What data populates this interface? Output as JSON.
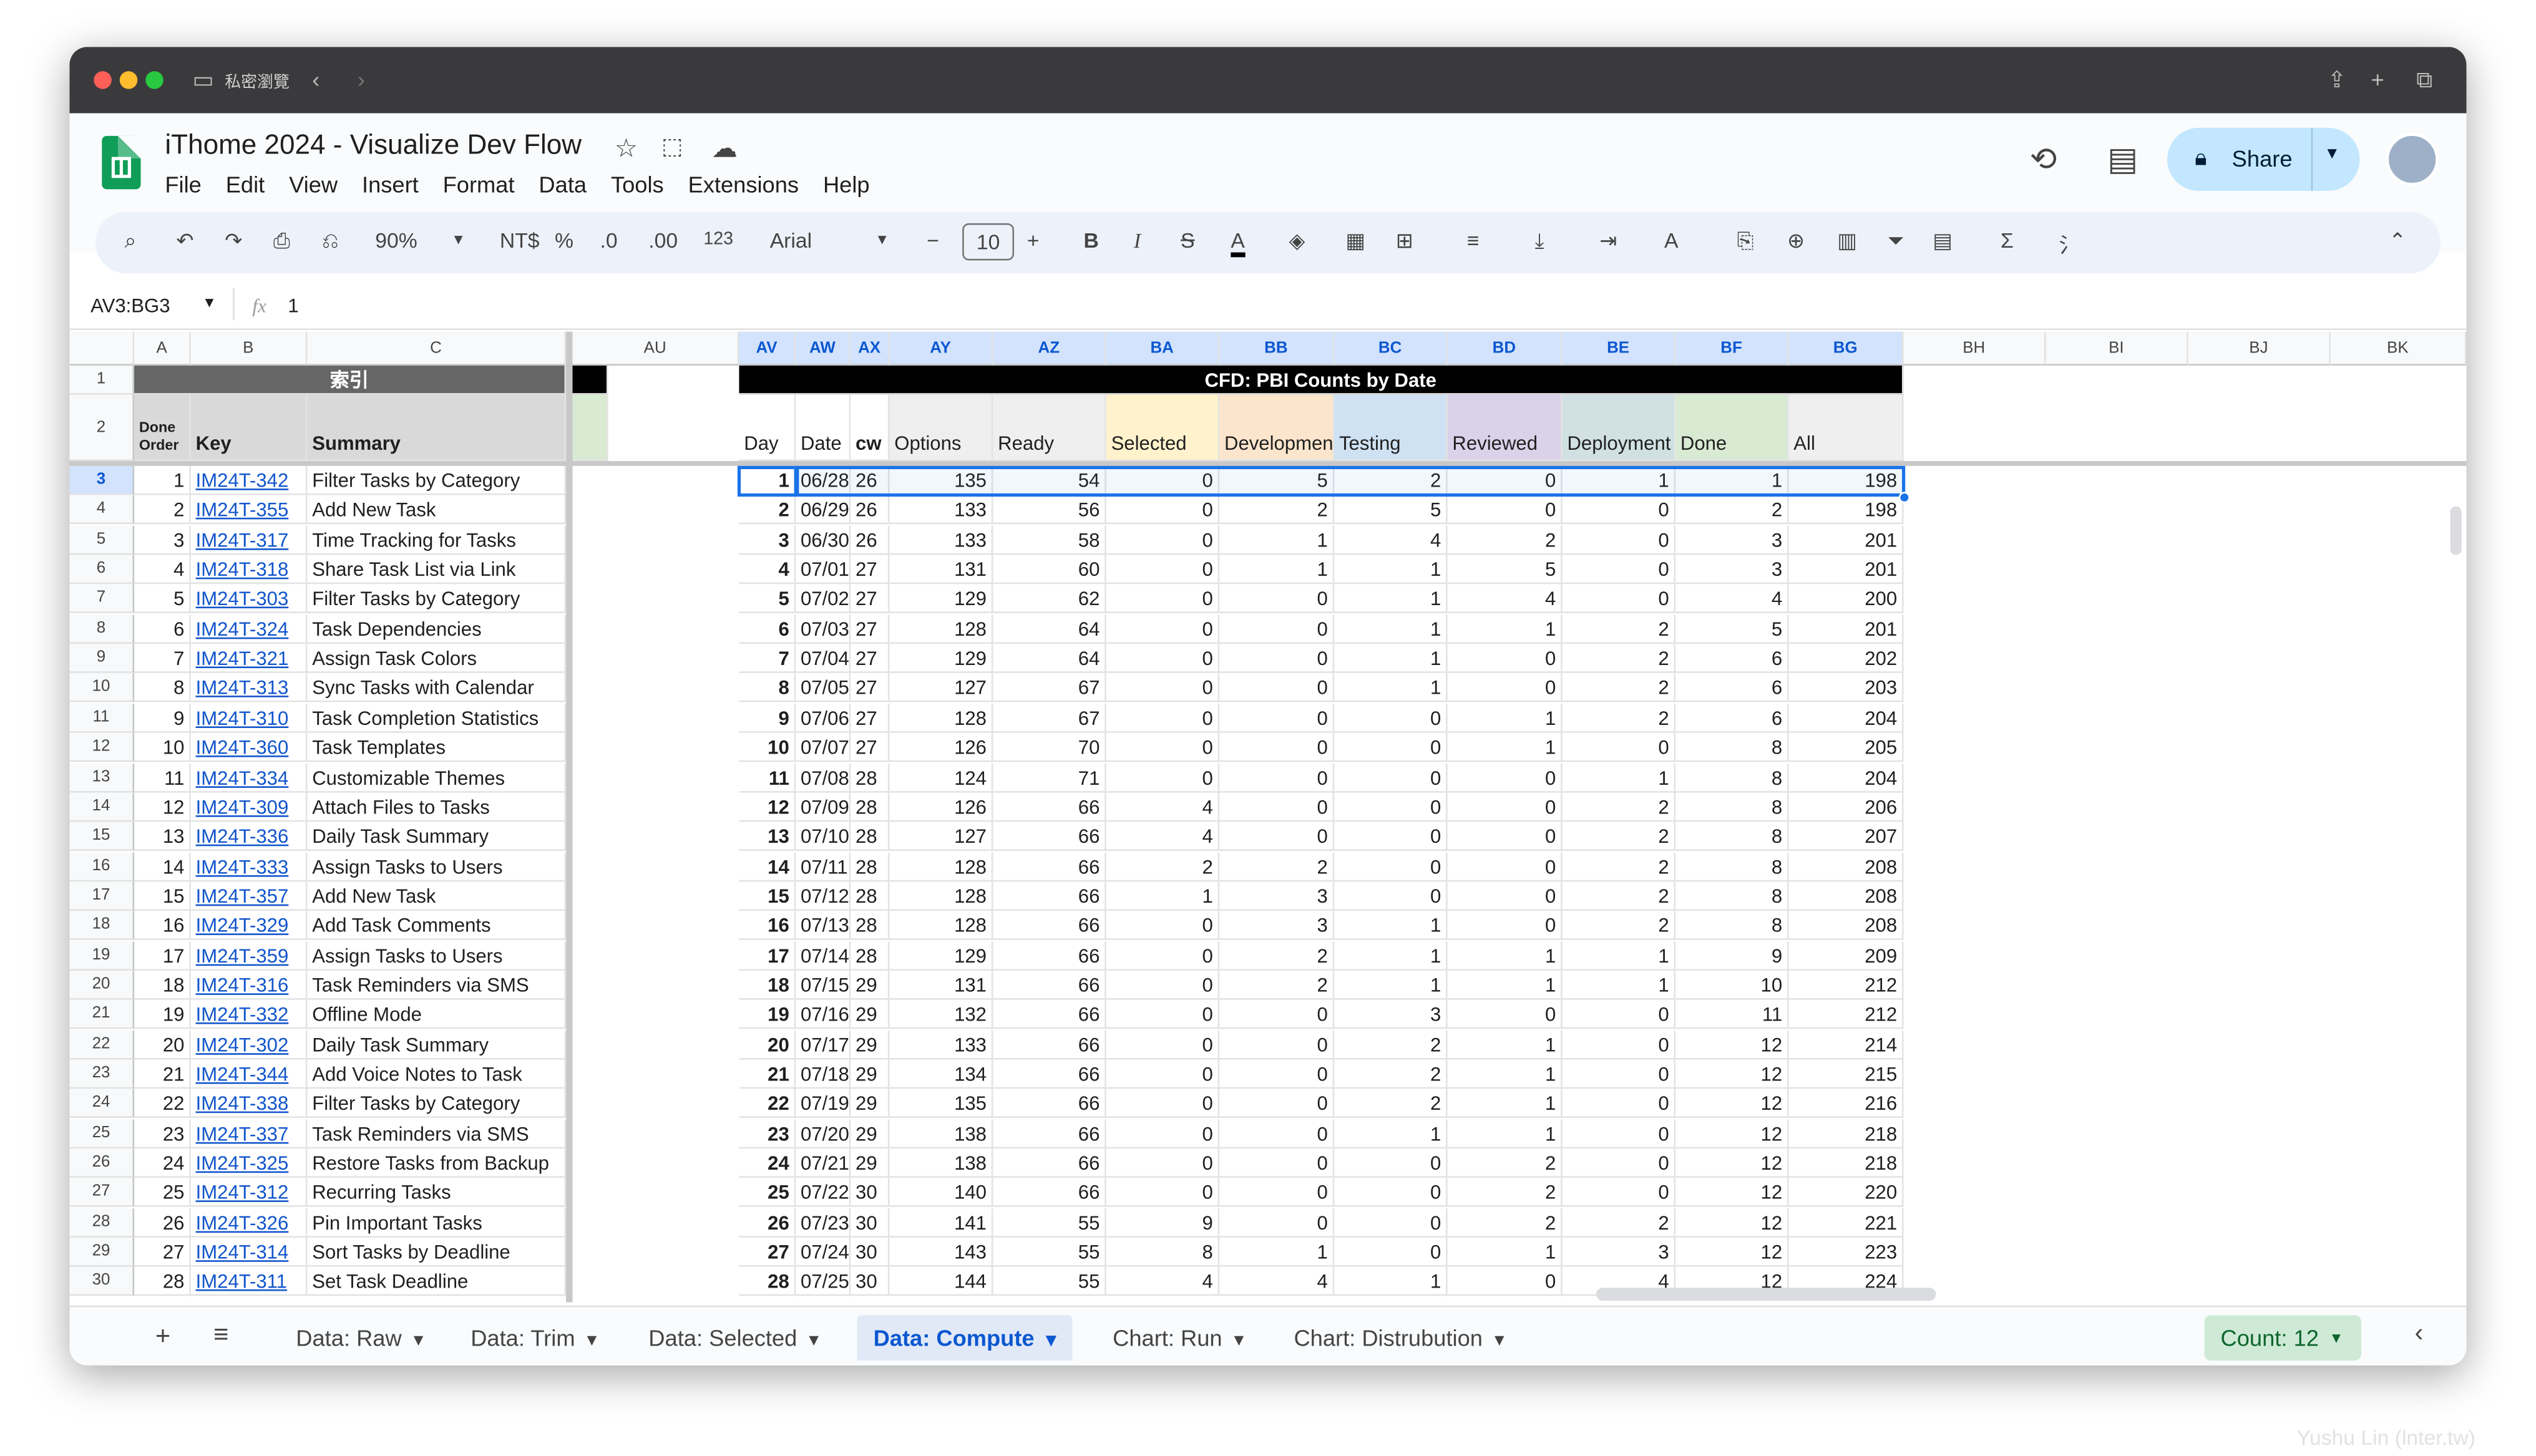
{
  "browser": {
    "private_label": "私密瀏覽"
  },
  "doc": {
    "title": "iThome 2024 - Visualize Dev Flow",
    "share_label": "Share"
  },
  "menu": [
    "File",
    "Edit",
    "View",
    "Insert",
    "Format",
    "Data",
    "Tools",
    "Extensions",
    "Help"
  ],
  "toolbar": {
    "zoom": "90%",
    "currency": "NT$",
    "percent": "%",
    "dec_dec": ".0",
    "dec_inc": ".00",
    "number_fmt": "123",
    "font": "Arial",
    "font_size": "10"
  },
  "formula_bar": {
    "range": "AV3:BG3",
    "fx": "fx",
    "value": "1"
  },
  "columns": {
    "A": "A",
    "B": "B",
    "C": "C",
    "AU": "AU",
    "AV": "AV",
    "AW": "AW",
    "AX": "AX",
    "AY": "AY",
    "AZ": "AZ",
    "BA": "BA",
    "BB": "BB",
    "BC": "BC",
    "BD": "BD",
    "BE": "BE",
    "BF": "BF",
    "BG": "BG",
    "BH": "BH",
    "BI": "BI",
    "BJ": "BJ",
    "BK": "BK"
  },
  "row1": {
    "index_title": "索引",
    "cfd_title": "CFD: PBI Counts by Date"
  },
  "row2": {
    "done_order": "Done Order",
    "key": "Key",
    "summary": "Summary",
    "day": "Day",
    "date": "Date",
    "cw": "cw",
    "options": "Options",
    "ready": "Ready",
    "selected": "Selected",
    "development": "Development",
    "testing": "Testing",
    "reviewed": "Reviewed",
    "deployment": "Deployment",
    "done": "Done",
    "all": "All"
  },
  "stage_colors": {
    "options": "#efefef",
    "selected": "#fff2cc",
    "development": "#fce5cd",
    "testing": "#cfe2f3",
    "reviewed": "#d9d2e9",
    "deployment": "#d0e0e3",
    "done": "#d9ead3"
  },
  "rows": [
    {
      "rn": "3",
      "done": "1",
      "key": "IM24T-342",
      "summary": "Filter Tasks by Category",
      "day": "1",
      "date": "06/28",
      "cw": "26",
      "options": "135",
      "ready": "54",
      "selected": "0",
      "dev": "5",
      "testing": "2",
      "reviewed": "0",
      "deploy": "1",
      "donec": "1",
      "all": "198"
    },
    {
      "rn": "4",
      "done": "2",
      "key": "IM24T-355",
      "summary": "Add New Task",
      "day": "2",
      "date": "06/29",
      "cw": "26",
      "options": "133",
      "ready": "56",
      "selected": "0",
      "dev": "2",
      "testing": "5",
      "reviewed": "0",
      "deploy": "0",
      "donec": "2",
      "all": "198"
    },
    {
      "rn": "5",
      "done": "3",
      "key": "IM24T-317",
      "summary": "Time Tracking for Tasks",
      "day": "3",
      "date": "06/30",
      "cw": "26",
      "options": "133",
      "ready": "58",
      "selected": "0",
      "dev": "1",
      "testing": "4",
      "reviewed": "2",
      "deploy": "0",
      "donec": "3",
      "all": "201"
    },
    {
      "rn": "6",
      "done": "4",
      "key": "IM24T-318",
      "summary": "Share Task List via Link",
      "day": "4",
      "date": "07/01",
      "cw": "27",
      "options": "131",
      "ready": "60",
      "selected": "0",
      "dev": "1",
      "testing": "1",
      "reviewed": "5",
      "deploy": "0",
      "donec": "3",
      "all": "201"
    },
    {
      "rn": "7",
      "done": "5",
      "key": "IM24T-303",
      "summary": "Filter Tasks by Category",
      "day": "5",
      "date": "07/02",
      "cw": "27",
      "options": "129",
      "ready": "62",
      "selected": "0",
      "dev": "0",
      "testing": "1",
      "reviewed": "4",
      "deploy": "0",
      "donec": "4",
      "all": "200"
    },
    {
      "rn": "8",
      "done": "6",
      "key": "IM24T-324",
      "summary": "Task Dependencies",
      "day": "6",
      "date": "07/03",
      "cw": "27",
      "options": "128",
      "ready": "64",
      "selected": "0",
      "dev": "0",
      "testing": "1",
      "reviewed": "1",
      "deploy": "2",
      "donec": "5",
      "all": "201"
    },
    {
      "rn": "9",
      "done": "7",
      "key": "IM24T-321",
      "summary": "Assign Task Colors",
      "day": "7",
      "date": "07/04",
      "cw": "27",
      "options": "129",
      "ready": "64",
      "selected": "0",
      "dev": "0",
      "testing": "1",
      "reviewed": "0",
      "deploy": "2",
      "donec": "6",
      "all": "202"
    },
    {
      "rn": "10",
      "done": "8",
      "key": "IM24T-313",
      "summary": "Sync Tasks with Calendar",
      "day": "8",
      "date": "07/05",
      "cw": "27",
      "options": "127",
      "ready": "67",
      "selected": "0",
      "dev": "0",
      "testing": "1",
      "reviewed": "0",
      "deploy": "2",
      "donec": "6",
      "all": "203"
    },
    {
      "rn": "11",
      "done": "9",
      "key": "IM24T-310",
      "summary": "Task Completion Statistics",
      "day": "9",
      "date": "07/06",
      "cw": "27",
      "options": "128",
      "ready": "67",
      "selected": "0",
      "dev": "0",
      "testing": "0",
      "reviewed": "1",
      "deploy": "2",
      "donec": "6",
      "all": "204"
    },
    {
      "rn": "12",
      "done": "10",
      "key": "IM24T-360",
      "summary": "Task Templates",
      "day": "10",
      "date": "07/07",
      "cw": "27",
      "options": "126",
      "ready": "70",
      "selected": "0",
      "dev": "0",
      "testing": "0",
      "reviewed": "1",
      "deploy": "0",
      "donec": "8",
      "all": "205"
    },
    {
      "rn": "13",
      "done": "11",
      "key": "IM24T-334",
      "summary": "Customizable Themes",
      "day": "11",
      "date": "07/08",
      "cw": "28",
      "options": "124",
      "ready": "71",
      "selected": "0",
      "dev": "0",
      "testing": "0",
      "reviewed": "0",
      "deploy": "1",
      "donec": "8",
      "all": "204"
    },
    {
      "rn": "14",
      "done": "12",
      "key": "IM24T-309",
      "summary": "Attach Files to Tasks",
      "day": "12",
      "date": "07/09",
      "cw": "28",
      "options": "126",
      "ready": "66",
      "selected": "4",
      "dev": "0",
      "testing": "0",
      "reviewed": "0",
      "deploy": "2",
      "donec": "8",
      "all": "206"
    },
    {
      "rn": "15",
      "done": "13",
      "key": "IM24T-336",
      "summary": "Daily Task Summary",
      "day": "13",
      "date": "07/10",
      "cw": "28",
      "options": "127",
      "ready": "66",
      "selected": "4",
      "dev": "0",
      "testing": "0",
      "reviewed": "0",
      "deploy": "2",
      "donec": "8",
      "all": "207"
    },
    {
      "rn": "16",
      "done": "14",
      "key": "IM24T-333",
      "summary": "Assign Tasks to Users",
      "day": "14",
      "date": "07/11",
      "cw": "28",
      "options": "128",
      "ready": "66",
      "selected": "2",
      "dev": "2",
      "testing": "0",
      "reviewed": "0",
      "deploy": "2",
      "donec": "8",
      "all": "208"
    },
    {
      "rn": "17",
      "done": "15",
      "key": "IM24T-357",
      "summary": "Add New Task",
      "day": "15",
      "date": "07/12",
      "cw": "28",
      "options": "128",
      "ready": "66",
      "selected": "1",
      "dev": "3",
      "testing": "0",
      "reviewed": "0",
      "deploy": "2",
      "donec": "8",
      "all": "208"
    },
    {
      "rn": "18",
      "done": "16",
      "key": "IM24T-329",
      "summary": "Add Task Comments",
      "day": "16",
      "date": "07/13",
      "cw": "28",
      "options": "128",
      "ready": "66",
      "selected": "0",
      "dev": "3",
      "testing": "1",
      "reviewed": "0",
      "deploy": "2",
      "donec": "8",
      "all": "208"
    },
    {
      "rn": "19",
      "done": "17",
      "key": "IM24T-359",
      "summary": "Assign Tasks to Users",
      "day": "17",
      "date": "07/14",
      "cw": "28",
      "options": "129",
      "ready": "66",
      "selected": "0",
      "dev": "2",
      "testing": "1",
      "reviewed": "1",
      "deploy": "1",
      "donec": "9",
      "all": "209"
    },
    {
      "rn": "20",
      "done": "18",
      "key": "IM24T-316",
      "summary": "Task Reminders via SMS",
      "day": "18",
      "date": "07/15",
      "cw": "29",
      "options": "131",
      "ready": "66",
      "selected": "0",
      "dev": "2",
      "testing": "1",
      "reviewed": "1",
      "deploy": "1",
      "donec": "10",
      "all": "212"
    },
    {
      "rn": "21",
      "done": "19",
      "key": "IM24T-332",
      "summary": "Offline Mode",
      "day": "19",
      "date": "07/16",
      "cw": "29",
      "options": "132",
      "ready": "66",
      "selected": "0",
      "dev": "0",
      "testing": "3",
      "reviewed": "0",
      "deploy": "0",
      "donec": "11",
      "all": "212"
    },
    {
      "rn": "22",
      "done": "20",
      "key": "IM24T-302",
      "summary": "Daily Task Summary",
      "day": "20",
      "date": "07/17",
      "cw": "29",
      "options": "133",
      "ready": "66",
      "selected": "0",
      "dev": "0",
      "testing": "2",
      "reviewed": "1",
      "deploy": "0",
      "donec": "12",
      "all": "214"
    },
    {
      "rn": "23",
      "done": "21",
      "key": "IM24T-344",
      "summary": "Add Voice Notes to Task",
      "day": "21",
      "date": "07/18",
      "cw": "29",
      "options": "134",
      "ready": "66",
      "selected": "0",
      "dev": "0",
      "testing": "2",
      "reviewed": "1",
      "deploy": "0",
      "donec": "12",
      "all": "215"
    },
    {
      "rn": "24",
      "done": "22",
      "key": "IM24T-338",
      "summary": "Filter Tasks by Category",
      "day": "22",
      "date": "07/19",
      "cw": "29",
      "options": "135",
      "ready": "66",
      "selected": "0",
      "dev": "0",
      "testing": "2",
      "reviewed": "1",
      "deploy": "0",
      "donec": "12",
      "all": "216"
    },
    {
      "rn": "25",
      "done": "23",
      "key": "IM24T-337",
      "summary": "Task Reminders via SMS",
      "day": "23",
      "date": "07/20",
      "cw": "29",
      "options": "138",
      "ready": "66",
      "selected": "0",
      "dev": "0",
      "testing": "1",
      "reviewed": "1",
      "deploy": "0",
      "donec": "12",
      "all": "218"
    },
    {
      "rn": "26",
      "done": "24",
      "key": "IM24T-325",
      "summary": "Restore Tasks from Backup",
      "day": "24",
      "date": "07/21",
      "cw": "29",
      "options": "138",
      "ready": "66",
      "selected": "0",
      "dev": "0",
      "testing": "0",
      "reviewed": "2",
      "deploy": "0",
      "donec": "12",
      "all": "218"
    },
    {
      "rn": "27",
      "done": "25",
      "key": "IM24T-312",
      "summary": "Recurring Tasks",
      "day": "25",
      "date": "07/22",
      "cw": "30",
      "options": "140",
      "ready": "66",
      "selected": "0",
      "dev": "0",
      "testing": "0",
      "reviewed": "2",
      "deploy": "0",
      "donec": "12",
      "all": "220"
    },
    {
      "rn": "28",
      "done": "26",
      "key": "IM24T-326",
      "summary": "Pin Important Tasks",
      "day": "26",
      "date": "07/23",
      "cw": "30",
      "options": "141",
      "ready": "55",
      "selected": "9",
      "dev": "0",
      "testing": "0",
      "reviewed": "2",
      "deploy": "2",
      "donec": "12",
      "all": "221"
    },
    {
      "rn": "29",
      "done": "27",
      "key": "IM24T-314",
      "summary": "Sort Tasks by Deadline",
      "day": "27",
      "date": "07/24",
      "cw": "30",
      "options": "143",
      "ready": "55",
      "selected": "8",
      "dev": "1",
      "testing": "0",
      "reviewed": "1",
      "deploy": "3",
      "donec": "12",
      "all": "223"
    },
    {
      "rn": "30",
      "done": "28",
      "key": "IM24T-311",
      "summary": "Set Task Deadline",
      "day": "28",
      "date": "07/25",
      "cw": "30",
      "options": "144",
      "ready": "55",
      "selected": "4",
      "dev": "4",
      "testing": "1",
      "reviewed": "0",
      "deploy": "4",
      "donec": "12",
      "all": "224"
    }
  ],
  "sheet_tabs": [
    "Data: Raw",
    "Data: Trim",
    "Data: Selected",
    "Data: Compute",
    "Chart: Run",
    "Chart: Distrubution"
  ],
  "active_tab": "Data: Compute",
  "status": {
    "count": "Count: 12"
  },
  "watermark": "Yushu Lin (lnter.tw)"
}
